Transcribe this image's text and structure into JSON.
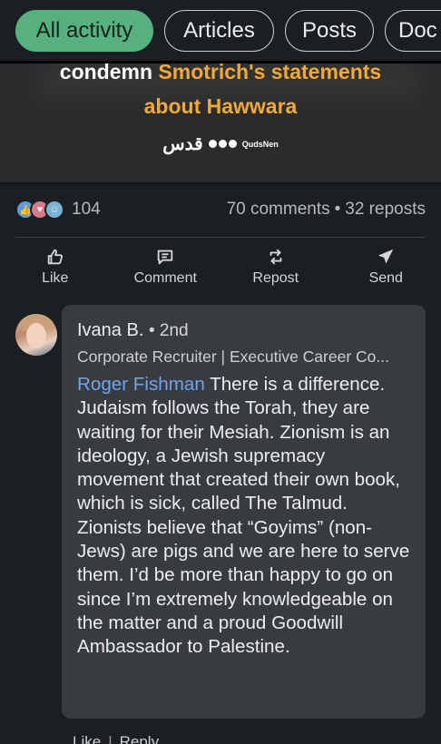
{
  "filters": {
    "chips": [
      "All activity",
      "Articles",
      "Posts",
      "Doc"
    ],
    "active": "All activity"
  },
  "post_image": {
    "line1_white": "condemn ",
    "line1_orange": "Smotrich's statements",
    "line2": "about Hawwara",
    "brand": "قدس",
    "handle": "QudsNen"
  },
  "social": {
    "reaction_count": "104",
    "comments": "70 comments",
    "separator": "•",
    "reposts": "32 reposts"
  },
  "actions": {
    "like": "Like",
    "comment": "Comment",
    "repost": "Repost",
    "send": "Send"
  },
  "comment": {
    "author": "Ivana B.",
    "degree": "• 2nd",
    "headline": "Corporate Recruiter | Executive Career Co...",
    "mention": "Roger Fishman",
    "text": " There is a difference. Judaism follows the Torah, they are waiting for their Mesiah. Zionism is an ideology, a Jewish supremacy movement that created their own book, which is sick, called The Talmud. Zionists believe that “Goyims” (non-Jews) are pigs and we are here to serve them. I’d be more than happy to go on since I’m extremely knowledgeable on the matter and a proud Goodwill Ambassador to Palestine."
  },
  "comment_actions": {
    "like": "Like",
    "separator": "|",
    "reply": "Reply"
  },
  "colors": {
    "background": "#1b1f23",
    "active_chip": "#57b07f",
    "mention": "#73a3e8",
    "bubble": "#383c41",
    "accent_orange": "#f2a93b"
  }
}
